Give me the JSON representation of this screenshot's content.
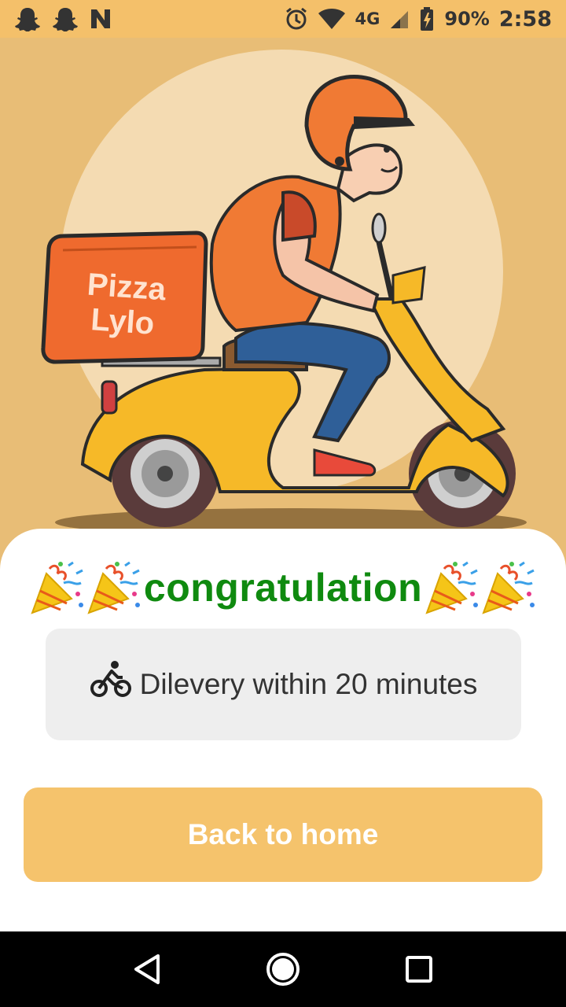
{
  "status_bar": {
    "battery": "90%",
    "time": "2:58",
    "network": "4G",
    "icons": [
      "snapchat-icon",
      "snapchat-icon",
      "n-icon",
      "alarm-icon",
      "wifi-icon",
      "signal-icon",
      "battery-icon"
    ]
  },
  "hero": {
    "box_text_line1": "Pizza",
    "box_text_line2": "Lylo"
  },
  "card": {
    "title": "congratulation",
    "delivery_text": "Dilevery within 20 minutes",
    "button_label": "Back to home"
  },
  "colors": {
    "status_bar": "#f4c06a",
    "hero_bg": "#e8bd76",
    "title_green": "#0f8a0f",
    "button": "#f5c36c",
    "delivery_box": "#eeeeee"
  },
  "nav_bar": {
    "icons": [
      "back-icon",
      "home-icon",
      "recents-icon"
    ]
  }
}
